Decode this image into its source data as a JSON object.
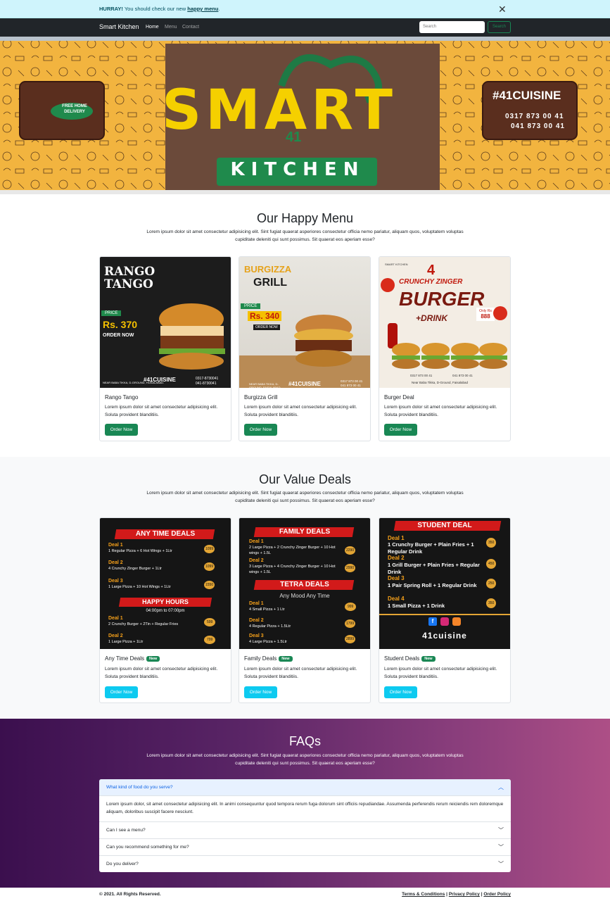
{
  "alert": {
    "strong": "HURRAY!",
    "text": " You should check our new ",
    "link": "happy menu",
    "end": ".",
    "close": "✕"
  },
  "nav": {
    "brand": "Smart Kitchen",
    "links": [
      "Home",
      "Menu",
      "Contact"
    ],
    "search_placeholder": "Search",
    "search_button": "Search"
  },
  "hero": {
    "title": "SMART",
    "subtitle": "KITCHEN",
    "number": "41",
    "left_sign": "FREE HOME DELIVERY",
    "right_tag": "#41CUISINE",
    "phone1": "0317 873 00 41",
    "phone2": "041 873 00 41"
  },
  "menu": {
    "title": "Our Happy Menu",
    "lead": "Lorem ipsum dolor sit amet consectetur adipisicing elit. Sint fugiat quaerat asperiores consectetur officia nemo pariatur, aliquam quos, voluptatem voluptas cupiditate deleniti qui sunt possimus. Sit quaerat eos aperiam esse?",
    "cards": [
      {
        "title": "Rango Tango",
        "text": "Lorem ipsum dolor sit amet consectetur adipisicing elit. Soluta provident blanditiis.",
        "button": "Order Now",
        "img_title": "RANGO TANGO",
        "price_label": "PRICE",
        "price": "Rs. 370",
        "img_cta": "ORDER NOW",
        "tag": "#41CUISINE",
        "addr": "NEAR BABA TIKKA, D-GROUND, FAISALABAD.",
        "ph1": "0317-8730041",
        "ph2": "041-8730041"
      },
      {
        "title": "Burgizza Grill",
        "text": "Lorem ipsum dolor sit amet consectetur adipisicing elit. Soluta provident blanditiis.",
        "button": "Order Now",
        "img_title": "BURGIZZA",
        "img_title2": "GRILL",
        "price_label": "PRICE",
        "price": "Rs. 340",
        "img_cta": "ORDER NOW",
        "tag": "#41CUISINE",
        "addr": "NEAR BABA TIKKA, D-GROUND, FAISALABAD.",
        "ph1": "0317 873 00 41",
        "ph2": "041 873 00 41"
      },
      {
        "title": "Burger Deal",
        "text": "Lorem ipsum dolor sit amet consectetur adipisicing elit. Soluta provident blanditiis.",
        "button": "Order Now",
        "img_top": "SMART KITCHEN",
        "img_num": "4",
        "img_l1": "CRUNCHY ZINGER",
        "img_l2": "BURGER",
        "img_l3": "+DRINK",
        "price_label": "Only Rs",
        "price": "888",
        "ph1": "0317 873 00 41",
        "ph2": "041 873 00 41",
        "addr": "Near Baba Tikka, D-Ground, Faisalabad"
      }
    ]
  },
  "deals": {
    "title": "Our Value Deals",
    "lead": "Lorem ipsum dolor sit amet consectetur adipisicing elit. Sint fugiat quaerat asperiores consectetur officia nemo pariatur, aliquam quos, voluptatem voluptas cupiditate deleniti qui sunt possimus. Sit quaerat eos aperiam esse?",
    "badge": "New",
    "cards": [
      {
        "title": "Any Time Deals",
        "text": "Lorem ipsum dolor sit amet consectetur adipisicing elit. Soluta provident blanditiis.",
        "button": "Order Now",
        "h1": "ANY TIME DEALS",
        "d1": "Deal 1",
        "d1t": "1 Regular Pizza + 6 Hot Wings + 1Ltr",
        "p1": "1099",
        "d2": "Deal 2",
        "d2t": "4 Crunchy Zinger Burger + 1Ltr",
        "p2": "1099",
        "d3": "Deal 3",
        "d3t": "1 Large Pizza + 10 Hot Wings + 1Ltr",
        "p3": "1550",
        "h2": "HAPPY HOURS",
        "hh": "04:00pm to 07:00pm",
        "e1": "Deal 1",
        "e1t": "2 Crunchy Burger + 2Tin + Regular Fries",
        "q1": "599",
        "e2": "Deal 2",
        "e2t": "1 Large Pizza + 1Ltr",
        "q2": "799"
      },
      {
        "title": "Family Deals",
        "text": "Lorem ipsum dolor sit amet consectetur adipisicing elit. Soluta provident blanditiis.",
        "button": "Order Now",
        "h1": "FAMILY DEALS",
        "d1": "Deal 1",
        "d1t": "2 Large Pizza + 2 Crunchy Zinger Burger + 10 Hot wings + 1.5L",
        "p1": "2290",
        "d2": "Deal 2",
        "d2t": "3 Large Pizza + 4 Crunchy Zinger Burger + 10 Hot wings + 1.5L",
        "p2": "2990",
        "h2": "TETRA DEALS",
        "sub": "Any Mood Any Time",
        "e1": "Deal 1",
        "e1t": "4 Small Pizza + 1 Ltr",
        "q1": "999",
        "e2": "Deal 2",
        "e2t": "4 Regular Pizza + 1.5Ltr",
        "q2": "1799",
        "e3": "Deal 3",
        "e3t": "4 Large Pizza + 1.5Ltr",
        "q3": "2899"
      },
      {
        "title": "Student Deals",
        "text": "Lorem ipsum dolor sit amet consectetur adipisicing elit. Soluta provident blanditiis.",
        "button": "Order Now",
        "h1": "STUDENT DEAL",
        "d1": "Deal 1",
        "d1t": "1 Crunchy Burger + Plain Fries + 1 Regular Drink",
        "p1": "350",
        "d2": "Deal 2",
        "d2t": "1 Grill Burger + Plain Fries + Regular Drink",
        "p2": "450",
        "d3": "Deal 3",
        "d3t": "1 Pair Spring Roll + 1 Regular Drink",
        "p3": "250",
        "d4": "Deal 4",
        "d4t": "1 Small Pizza + 1 Drink",
        "p4": "350",
        "brand": "41cuisine"
      }
    ]
  },
  "faq": {
    "title": "FAQs",
    "lead": "Lorem ipsum dolor sit amet consectetur adipisicing elit. Sint fugiat quaerat asperiores consectetur officia nemo pariatur, aliquam quos, voluptatem voluptas cupiditate deleniti qui sunt possimus. Sit quaerat eos aperiam esse?",
    "items": [
      {
        "q": "What kind of food do you serve?",
        "a": "Lorem ipsum dolor, sit amet consectetur adipisicing elit. In animi consequuntur quod tempora rerum fuga dolorum sint officiis repudiandae. Assumenda perferendis rerum reiciendis rem doloremque aliquam, doloribus suscipit facere nesciunt."
      },
      {
        "q": "Can I see a menu?"
      },
      {
        "q": "Can you recommend something for me?"
      },
      {
        "q": "Do you deliver?"
      }
    ]
  },
  "footer": {
    "copy": "© 2021. All Rights Reserved.",
    "links": [
      "Terms & Conditions",
      "Privacy Policy",
      "Order Policy"
    ],
    "sep": " | "
  },
  "colors": {
    "success": "#198754",
    "info": "#0dcaf0",
    "dark": "#212529",
    "alert_bg": "#cff4fc"
  }
}
